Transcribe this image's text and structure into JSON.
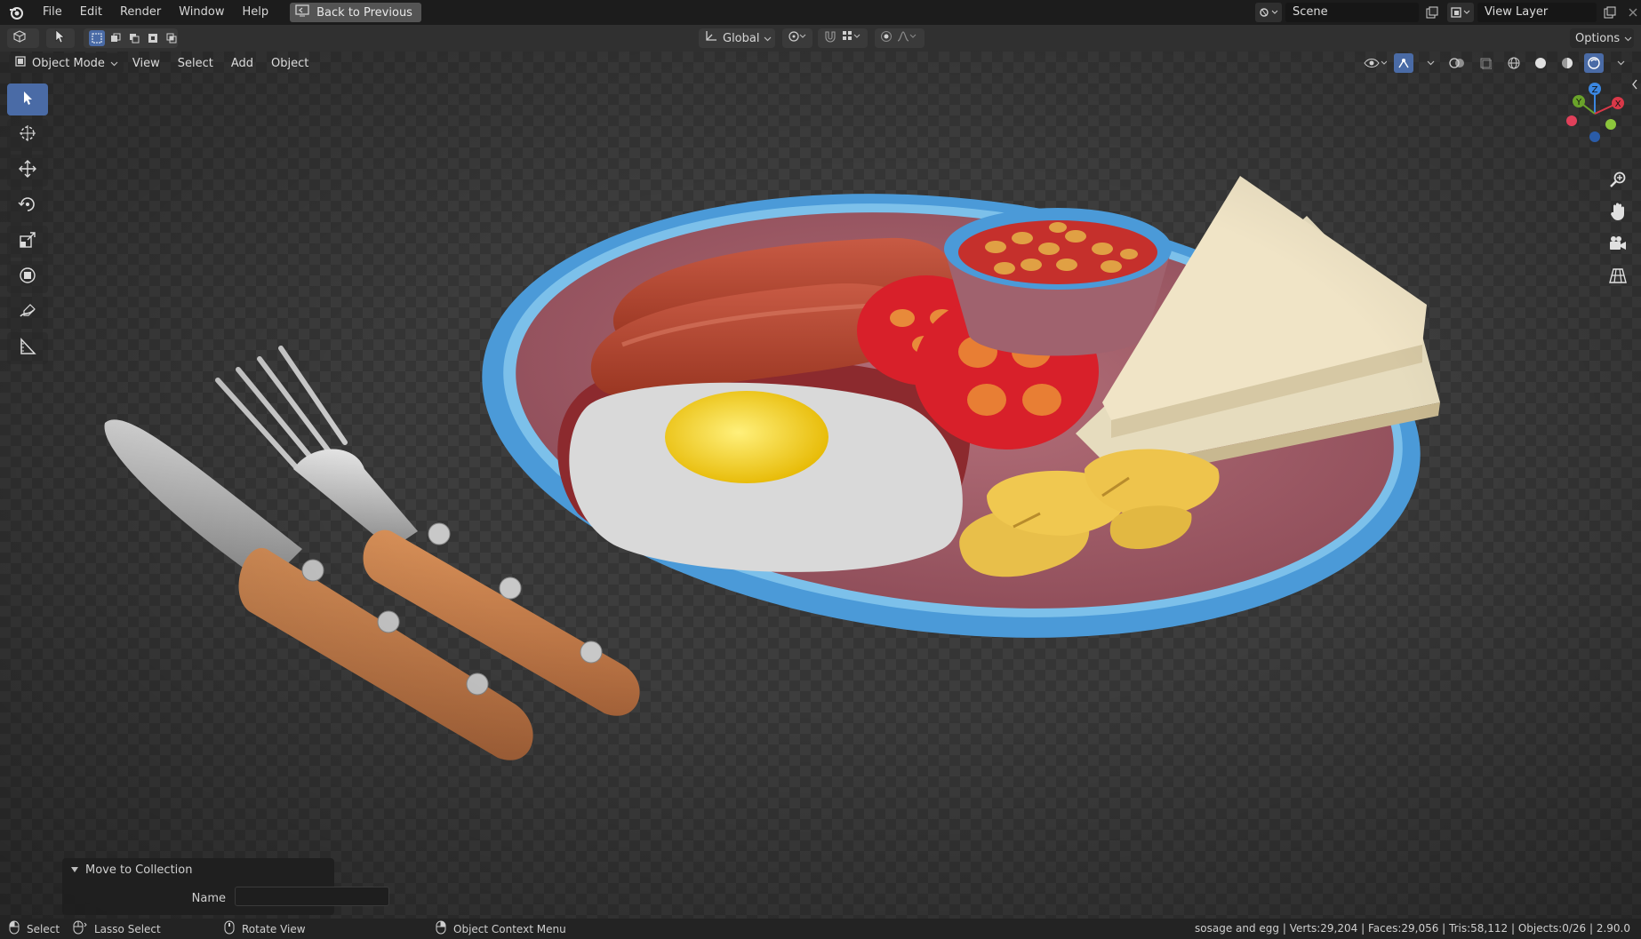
{
  "menu": {
    "items": [
      "File",
      "Edit",
      "Render",
      "Window",
      "Help"
    ],
    "back_label": "Back to Previous"
  },
  "scene": {
    "name": "Scene",
    "view_layer": "View Layer"
  },
  "tool_header": {
    "orientation": "Global",
    "options_label": "Options"
  },
  "viewport_header": {
    "mode": "Object Mode",
    "menus": [
      "View",
      "Select",
      "Add",
      "Object"
    ]
  },
  "gizmo": {
    "z_label": "Z",
    "y_label": "Y",
    "x_label": "X"
  },
  "operator_panel": {
    "title": "Move to Collection",
    "name_label": "Name",
    "name_value": ""
  },
  "status": {
    "select": "Select",
    "lasso": "Lasso Select",
    "rotate": "Rotate View",
    "context": "Object Context Menu",
    "stats": "sosage and egg | Verts:29,204 | Faces:29,056 | Tris:58,112 | Objects:0/26 | 2.90.0"
  },
  "colors": {
    "accent": "#4a6ba6",
    "plate_rim": "#4b9ad8",
    "plate": "#a8646e",
    "sausage": "#b84430",
    "tomato": "#d8202a",
    "yolk": "#f2d21a",
    "handle": "#c8804a"
  }
}
